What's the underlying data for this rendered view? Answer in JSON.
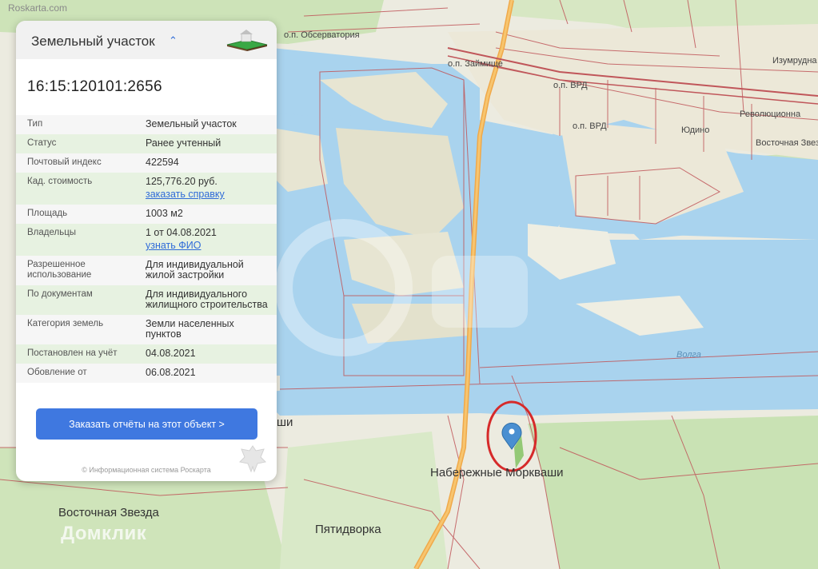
{
  "watermark": "Roskarta.com",
  "domklik": "Домклик",
  "map_labels": {
    "obs": "о.п. Обсерватория",
    "zaim": "о.п. Займище",
    "vrd1": "о.п. ВРД",
    "vrd2": "о.п. ВРД",
    "izum": "Изумрудна",
    "revol": "Революционна",
    "yudino": "Юдино",
    "vost": "Восточная Звезд",
    "volga": "Волга",
    "naber": "Набережные Моркваши",
    "vz": "Восточная Звезда",
    "pyat": "Пятидворка",
    "shi": "ши"
  },
  "panel": {
    "title": "Земельный участок",
    "cad_number": "16:15:120101:2656",
    "rows": [
      {
        "k": "Тип",
        "v": "Земельный участок"
      },
      {
        "k": "Статус",
        "v": "Ранее учтенный"
      },
      {
        "k": "Почтовый индекс",
        "v": "422594"
      },
      {
        "k": "Кад. стоимость",
        "v": "125,776.20 руб.",
        "link": "заказать справку"
      },
      {
        "k": "Площадь",
        "v": "1003 м2"
      },
      {
        "k": "Владельцы",
        "v": "1 от 04.08.2021",
        "link": "узнать ФИО"
      },
      {
        "k": "Разрешенное использование",
        "v": "Для индивидуальной жилой застройки"
      },
      {
        "k": "По документам",
        "v": "Для индивидуального жилищного строительства"
      },
      {
        "k": "Категория земель",
        "v": "Земли населенных пунктов"
      },
      {
        "k": "Постановлен на учёт",
        "v": "04.08.2021"
      },
      {
        "k": "Обовление от",
        "v": "06.08.2021"
      }
    ],
    "order_button": "Заказать отчёты на этот объект >",
    "footer": "© Информационная система Роскарта"
  }
}
